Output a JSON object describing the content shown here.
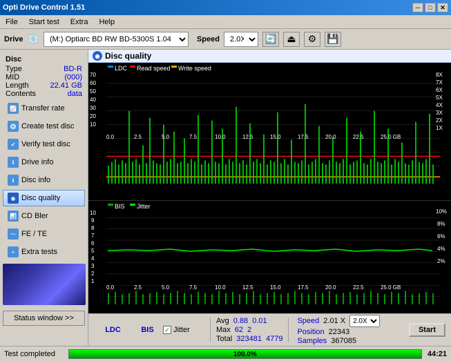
{
  "titleBar": {
    "title": "Opti Drive Control 1.51",
    "minimize": "─",
    "maximize": "□",
    "close": "✕"
  },
  "menu": {
    "items": [
      "File",
      "Start test",
      "Extra",
      "Help"
    ]
  },
  "drive": {
    "label": "Drive",
    "selected": "(M:)  Optiarc BD RW BD-5300S 1.04",
    "speedLabel": "Speed",
    "speedSelected": "2.0X"
  },
  "disc": {
    "sectionLabel": "Disc",
    "typeLabel": "Type",
    "typeValue": "BD-R",
    "midLabel": "MID",
    "midValue": "(000)",
    "lengthLabel": "Length",
    "lengthValue": "22.41 GB",
    "contentsLabel": "Contents",
    "contentsValue": "data"
  },
  "sidebar": {
    "items": [
      "Transfer rate",
      "Create test disc",
      "Verify test disc",
      "Drive info",
      "Disc info",
      "Disc quality",
      "CD Bler",
      "FE / TE",
      "Extra tests"
    ],
    "activeItem": 5,
    "statusBtn": "Status window >>"
  },
  "discQuality": {
    "header": "Disc quality"
  },
  "chart1": {
    "legend": {
      "ldc": "LDC",
      "readSpeed": "Read speed",
      "writeSpeed": "Write speed"
    },
    "leftAxis": [
      "70",
      "60",
      "50",
      "40",
      "30",
      "20",
      "10"
    ],
    "rightAxis": [
      "8X",
      "7X",
      "6X",
      "5X",
      "4X",
      "3X",
      "2X",
      "1X"
    ],
    "bottomAxis": [
      "0.0",
      "2.5",
      "5.0",
      "7.5",
      "10.0",
      "12.5",
      "15.0",
      "17.5",
      "20.0",
      "22.5",
      "25.0 GB"
    ]
  },
  "chart2": {
    "legend": {
      "bis": "BIS",
      "jitter": "Jitter"
    },
    "leftAxis": [
      "10",
      "9",
      "8",
      "7",
      "6",
      "5",
      "4",
      "3",
      "2",
      "1"
    ],
    "rightAxis": [
      "10%",
      "8%",
      "6%",
      "4%",
      "2%"
    ],
    "bottomAxis": [
      "0.0",
      "2.5",
      "5.0",
      "7.5",
      "10.0",
      "12.5",
      "15.0",
      "17.5",
      "20.0",
      "22.5",
      "25.0 GB"
    ]
  },
  "statsRow": {
    "ldcLabel": "LDC",
    "bisLabel": "BIS",
    "jitterLabel": "Jitter",
    "jitterChecked": true,
    "avgLabel": "Avg",
    "avgLdc": "0.88",
    "avgBis": "0.01",
    "maxLabel": "Max",
    "maxLdc": "62",
    "maxBis": "2",
    "totalLabel": "Total",
    "totalLdc": "323481",
    "totalBis": "4779",
    "speedLabel": "Speed",
    "speedValue": "2.01 X",
    "speedSelect": "2.0X",
    "positionLabel": "Position",
    "positionValue": "22343",
    "samplesLabel": "Samples",
    "samplesValue": "367085",
    "startBtn": "Start"
  },
  "bottomBar": {
    "statusText": "Test completed",
    "progressPercent": 100,
    "progressLabel": "100.0%",
    "time": "44:21"
  }
}
